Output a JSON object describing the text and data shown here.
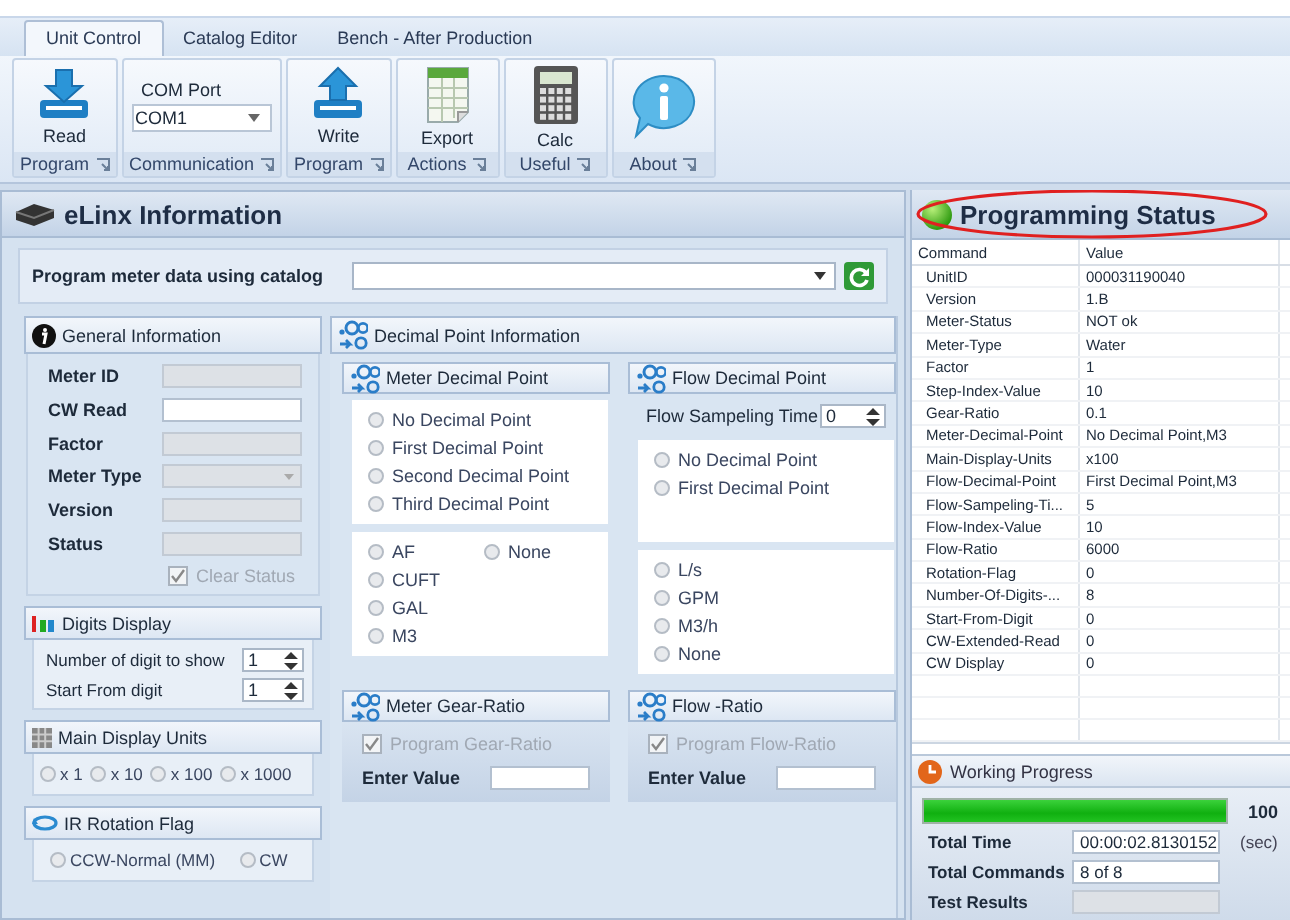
{
  "tabs": [
    {
      "label": "Unit Control",
      "selected": true
    },
    {
      "label": "Catalog Editor",
      "selected": false
    },
    {
      "label": "Bench  - After Production",
      "selected": false
    }
  ],
  "ribbon": [
    {
      "kind": "read",
      "label": "Read",
      "group": "Program"
    },
    {
      "kind": "combo",
      "caption": "COM Port",
      "value": "COM1",
      "group": "Communication"
    },
    {
      "kind": "write",
      "label": "Write",
      "group": "Program"
    },
    {
      "kind": "export",
      "label": "Export",
      "group": "Actions"
    },
    {
      "kind": "calc",
      "label": "Calc",
      "group": "Useful"
    },
    {
      "kind": "about",
      "group": "About"
    }
  ],
  "info_panel": {
    "title": "eLinx Information",
    "catalog": {
      "label": "Program meter data using catalog"
    },
    "general": {
      "title": "General Information",
      "fields": [
        {
          "label": "Meter ID",
          "kind": "text",
          "disabled": true
        },
        {
          "label": "CW Read",
          "kind": "text",
          "disabled": false
        },
        {
          "label": "Factor",
          "kind": "text",
          "disabled": true
        },
        {
          "label": "Meter Type",
          "kind": "combo",
          "disabled": true
        },
        {
          "label": "Version",
          "kind": "text",
          "disabled": true
        },
        {
          "label": "Status",
          "kind": "text",
          "disabled": true
        }
      ],
      "clear_status": {
        "label": "Clear Status",
        "checked": true,
        "disabled": true
      }
    },
    "digits": {
      "title": "Digits Display",
      "spinners": [
        {
          "label": "Number of digit to show",
          "value": "1"
        },
        {
          "label": "Start From digit",
          "value": "1"
        }
      ]
    },
    "units": {
      "title": "Main Display Units",
      "options": [
        {
          "label": "x 1",
          "selected": false
        },
        {
          "label": "x 10",
          "selected": false
        },
        {
          "label": "x 100",
          "selected": false
        },
        {
          "label": "x 1000",
          "selected": false
        }
      ]
    },
    "rotation": {
      "title": "IR Rotation Flag",
      "options": [
        {
          "label": "CCW-Normal (MM)",
          "selected": false
        },
        {
          "label": "CW",
          "selected": false
        }
      ]
    },
    "decimal": {
      "title": "Decimal Point  Information",
      "meter": {
        "title": "Meter Decimal Point",
        "points": [
          {
            "label": "No Decimal Point",
            "selected": false
          },
          {
            "label": "First Decimal Point",
            "selected": false
          },
          {
            "label": "Second Decimal Point",
            "selected": false
          },
          {
            "label": "Third Decimal Point",
            "selected": false
          }
        ],
        "units": [
          {
            "label": "AF",
            "selected": false
          },
          {
            "label": "None",
            "selected": false
          },
          {
            "label": "CUFT",
            "selected": false
          },
          {
            "label": "GAL",
            "selected": false
          },
          {
            "label": "M3",
            "selected": false
          }
        ]
      },
      "flow": {
        "title": "Flow Decimal Point",
        "sampling": {
          "label": "Flow Sampeling Time",
          "value": "0"
        },
        "points": [
          {
            "label": "No Decimal Point",
            "selected": false
          },
          {
            "label": "First Decimal Point",
            "selected": false
          }
        ],
        "units": [
          {
            "label": "L/s",
            "selected": false
          },
          {
            "label": "GPM",
            "selected": false
          },
          {
            "label": "M3/h",
            "selected": false
          },
          {
            "label": "None",
            "selected": false
          }
        ]
      },
      "ratios": [
        {
          "title": "Meter Gear-Ratio",
          "check": {
            "label": "Program Gear-Ratio",
            "checked": true,
            "disabled": true
          },
          "entry": {
            "label": "Enter Value"
          }
        },
        {
          "title": "Flow -Ratio",
          "check": {
            "label": "Program Flow-Ratio",
            "checked": true,
            "disabled": true
          },
          "entry": {
            "label": "Enter Value"
          }
        }
      ]
    }
  },
  "status_panel": {
    "title": "Programming Status",
    "highlighted": true,
    "columns": [
      "Command",
      "Value"
    ],
    "rows": [
      [
        "UnitID",
        "000031190040"
      ],
      [
        "Version",
        "1.B"
      ],
      [
        "Meter-Status",
        "NOT ok"
      ],
      [
        "Meter-Type",
        "Water"
      ],
      [
        "Factor",
        "1"
      ],
      [
        "Step-Index-Value",
        "10"
      ],
      [
        "Gear-Ratio",
        "0.1"
      ],
      [
        "Meter-Decimal-Point",
        "No Decimal Point,M3"
      ],
      [
        "Main-Display-Units",
        "x100"
      ],
      [
        "Flow-Decimal-Point",
        "First Decimal Point,M3"
      ],
      [
        "Flow-Sampeling-Ti...",
        "5"
      ],
      [
        "Flow-Index-Value",
        "10"
      ],
      [
        "Flow-Ratio",
        "6000"
      ],
      [
        "Rotation-Flag",
        "0"
      ],
      [
        "Number-Of-Digits-...",
        "8"
      ],
      [
        "Start-From-Digit",
        "0"
      ],
      [
        "CW-Extended-Read",
        "0"
      ],
      [
        "CW Display",
        "0"
      ]
    ],
    "progress": {
      "title": "Working Progress",
      "level": 1,
      "percent": "100",
      "fields": [
        {
          "label": "Total Time",
          "value": "00:00:02.8130152",
          "unit": "(sec)",
          "disabled": false
        },
        {
          "label": "Total Commands",
          "value": "8 of 8",
          "disabled": false
        },
        {
          "label": "Test Results",
          "disabled": true
        }
      ]
    }
  }
}
